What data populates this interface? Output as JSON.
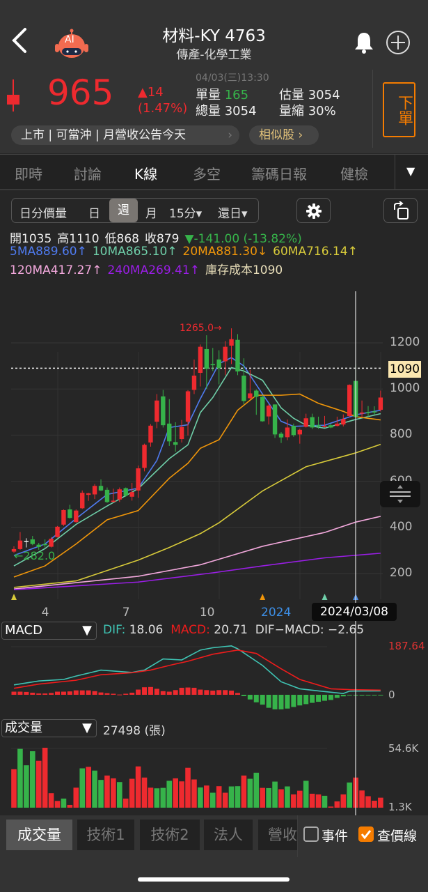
{
  "header": {
    "title": "材料-KY 4763",
    "subtitle": "傳產-化學工業",
    "ai_label": "AI"
  },
  "quote": {
    "price": "965",
    "change": "▲14",
    "change_pct": "(1.47%)",
    "datetime": "04/03(三)13:30",
    "single_vol_label": "單量",
    "single_vol": "165",
    "total_vol_label": "總量",
    "total_vol": "3054",
    "est_vol_label": "估量",
    "est_vol": "3054",
    "vol_ratio_label": "量縮",
    "vol_ratio": "30%",
    "order_button": "下單",
    "tags": "上市 | 可當沖 | 月營收公告今天",
    "similar": "相似股"
  },
  "tabs": [
    {
      "label": "即時"
    },
    {
      "label": "討論"
    },
    {
      "label": "K線"
    },
    {
      "label": "多空"
    },
    {
      "label": "籌碼日報"
    },
    {
      "label": "健檢"
    }
  ],
  "periods": [
    {
      "label": "日分價量"
    },
    {
      "label": "日"
    },
    {
      "label": "週"
    },
    {
      "label": "月"
    },
    {
      "label": "15分▾"
    },
    {
      "label": "還日▾"
    }
  ],
  "ohlc": {
    "open": "開1035",
    "high": "高1110",
    "low": "低868",
    "close": "收879",
    "change": "▼-141.00 (-13.82%)"
  },
  "ma_labels": [
    {
      "text": "5MA889.60↑",
      "color": "#4f7bf0"
    },
    {
      "text": "10MA865.10↑",
      "color": "#6fcfa9"
    },
    {
      "text": "20MA881.30↓",
      "color": "#f0960a"
    },
    {
      "text": "60MA716.14↑",
      "color": "#d8cb3a"
    },
    {
      "text": "120MA417.27↑",
      "color": "#f2a8dc"
    },
    {
      "text": "240MA269.41↑",
      "color": "#9a1ee6"
    }
  ],
  "cost_label": "庫存成本1090",
  "colors": {
    "up": "#ee2a2f",
    "down": "#36b34a",
    "accent": "#f57c00"
  },
  "chart_data": {
    "type": "candlestick",
    "price_ticks": [
      1200,
      1000,
      800,
      600,
      400,
      200
    ],
    "x_labels": [
      {
        "text": "4",
        "i": 5
      },
      {
        "text": "7",
        "i": 18
      },
      {
        "text": "10",
        "i": 31
      },
      {
        "text": "2024",
        "i": 42
      }
    ],
    "crosshair_date": "2024/03/08",
    "crosshair_index": 55,
    "cost_line": 1090,
    "cost_line_label": "1090",
    "high_annotation": "1265.0→",
    "low_annotation": "←282.0",
    "candles": [
      [
        295,
        318,
        290,
        306
      ],
      [
        306,
        380,
        303,
        343
      ],
      [
        341,
        353,
        313,
        341
      ],
      [
        348,
        363,
        323,
        328
      ],
      [
        325,
        333,
        303,
        315
      ],
      [
        328,
        348,
        313,
        323
      ],
      [
        316,
        358,
        313,
        351
      ],
      [
        358,
        406,
        356,
        403
      ],
      [
        412,
        478,
        406,
        475
      ],
      [
        478,
        498,
        438,
        441
      ],
      [
        423,
        478,
        420,
        473
      ],
      [
        483,
        560,
        480,
        550
      ],
      [
        541,
        550,
        515,
        548
      ],
      [
        543,
        588,
        523,
        580
      ],
      [
        580,
        608,
        558,
        560
      ],
      [
        563,
        573,
        506,
        510
      ],
      [
        511,
        568,
        508,
        516
      ],
      [
        521,
        573,
        510,
        565
      ],
      [
        570,
        573,
        533,
        538
      ],
      [
        533,
        593,
        516,
        553
      ],
      [
        560,
        668,
        528,
        656
      ],
      [
        658,
        763,
        643,
        758
      ],
      [
        768,
        848,
        750,
        841
      ],
      [
        858,
        978,
        830,
        950
      ],
      [
        968,
        996,
        833,
        843
      ],
      [
        850,
        956,
        753,
        773
      ],
      [
        770,
        856,
        728,
        758
      ],
      [
        783,
        866,
        768,
        835
      ],
      [
        858,
        995,
        798,
        990
      ],
      [
        996,
        1128,
        978,
        1058
      ],
      [
        1070,
        1193,
        1011,
        1183
      ],
      [
        1173,
        1233,
        1000,
        1088
      ],
      [
        1108,
        1178,
        1078,
        1103
      ],
      [
        1128,
        1168,
        1020,
        1090
      ],
      [
        1120,
        1208,
        1060,
        1183
      ],
      [
        1188,
        1263,
        1108,
        1216
      ],
      [
        1213,
        1238,
        1060,
        1076
      ],
      [
        1058,
        1133,
        933,
        948
      ],
      [
        960,
        1083,
        953,
        981
      ],
      [
        993,
        998,
        888,
        966
      ],
      [
        966,
        973,
        858,
        860
      ],
      [
        881,
        933,
        846,
        928
      ],
      [
        933,
        933,
        788,
        803
      ],
      [
        806,
        813,
        766,
        790
      ],
      [
        791,
        868,
        778,
        833
      ],
      [
        840,
        850,
        793,
        800
      ],
      [
        803,
        828,
        763,
        823
      ],
      [
        836,
        893,
        833,
        873
      ],
      [
        878,
        893,
        826,
        833
      ],
      [
        843,
        880,
        828,
        838
      ],
      [
        836,
        883,
        833,
        840
      ],
      [
        843,
        850,
        830,
        833
      ],
      [
        840,
        880,
        838,
        850
      ],
      [
        846,
        890,
        838,
        870
      ],
      [
        883,
        1020,
        878,
        1018
      ],
      [
        1035,
        1110,
        868,
        879
      ],
      [
        893,
        950,
        878,
        898
      ],
      [
        900,
        926,
        880,
        896
      ],
      [
        903,
        925,
        888,
        898
      ],
      [
        910,
        993,
        903,
        963
      ]
    ],
    "ma": {
      "5MA": [
        [
          0,
          278
        ],
        [
          5,
          328
        ],
        [
          10,
          438
        ],
        [
          15,
          543
        ],
        [
          20,
          570
        ],
        [
          23,
          690
        ],
        [
          25,
          833
        ],
        [
          28,
          845
        ],
        [
          30,
          958
        ],
        [
          33,
          1110
        ],
        [
          35,
          1136
        ],
        [
          37,
          1100
        ],
        [
          40,
          978
        ],
        [
          43,
          860
        ],
        [
          45,
          838
        ],
        [
          50,
          843
        ],
        [
          55,
          888
        ],
        [
          59,
          908
        ]
      ],
      "10MA": [
        [
          0,
          233
        ],
        [
          5,
          308
        ],
        [
          10,
          413
        ],
        [
          15,
          493
        ],
        [
          20,
          568
        ],
        [
          25,
          698
        ],
        [
          28,
          758
        ],
        [
          30,
          898
        ],
        [
          32,
          963
        ],
        [
          35,
          1093
        ],
        [
          37,
          1078
        ],
        [
          40,
          1038
        ],
        [
          43,
          918
        ],
        [
          45,
          873
        ],
        [
          47,
          843
        ],
        [
          50,
          830
        ],
        [
          55,
          868
        ],
        [
          59,
          893
        ]
      ],
      "20MA": [
        [
          0,
          185
        ],
        [
          5,
          233
        ],
        [
          10,
          328
        ],
        [
          15,
          433
        ],
        [
          20,
          473
        ],
        [
          25,
          613
        ],
        [
          28,
          678
        ],
        [
          30,
          743
        ],
        [
          33,
          780
        ],
        [
          36,
          908
        ],
        [
          39,
          973
        ],
        [
          43,
          973
        ],
        [
          46,
          978
        ],
        [
          49,
          938
        ],
        [
          53,
          903
        ],
        [
          55,
          880
        ],
        [
          59,
          866
        ]
      ],
      "60MA": [
        [
          0,
          140
        ],
        [
          10,
          168
        ],
        [
          20,
          258
        ],
        [
          25,
          313
        ],
        [
          30,
          373
        ],
        [
          33,
          420
        ],
        [
          40,
          558
        ],
        [
          47,
          663
        ],
        [
          55,
          723
        ],
        [
          59,
          760
        ]
      ],
      "120MA": [
        [
          0,
          133
        ],
        [
          20,
          188
        ],
        [
          30,
          238
        ],
        [
          33,
          262
        ],
        [
          40,
          318
        ],
        [
          50,
          378
        ],
        [
          55,
          423
        ],
        [
          59,
          448
        ]
      ],
      "240MA": [
        [
          0,
          130
        ],
        [
          20,
          163
        ],
        [
          32,
          203
        ],
        [
          40,
          233
        ],
        [
          50,
          268
        ],
        [
          59,
          288
        ]
      ]
    },
    "markers": [
      {
        "i": 0,
        "color": "#d8cb3a"
      },
      {
        "i": 40,
        "color": "#f0960a"
      },
      {
        "i": 50,
        "color": "#6fcfa9"
      },
      {
        "i": 55,
        "color": "#4f8fe6"
      }
    ],
    "macd": {
      "name": "MACD",
      "dif_label": "DIF:",
      "dif": "18.06",
      "macd_label": "MACD:",
      "macd": "20.71",
      "diff_label": "DIF−MACD:",
      "diff": "−2.65",
      "ymax_label": "187.64",
      "zero_label": "0",
      "ymax": 187.64,
      "dif_series": [
        [
          0,
          38
        ],
        [
          4,
          53
        ],
        [
          8,
          59
        ],
        [
          10,
          72
        ],
        [
          14,
          95
        ],
        [
          19,
          86
        ],
        [
          21,
          95
        ],
        [
          24,
          138
        ],
        [
          27,
          134
        ],
        [
          30,
          172
        ],
        [
          32,
          181
        ],
        [
          35,
          188
        ],
        [
          36,
          177
        ],
        [
          40,
          113
        ],
        [
          43,
          50
        ],
        [
          46,
          23
        ],
        [
          49,
          15
        ],
        [
          53,
          5
        ],
        [
          54,
          14
        ],
        [
          59,
          15
        ]
      ],
      "macd_series": [
        [
          0,
          25
        ],
        [
          4,
          41
        ],
        [
          10,
          56
        ],
        [
          14,
          77
        ],
        [
          19,
          85
        ],
        [
          22,
          95
        ],
        [
          25,
          113
        ],
        [
          28,
          129
        ],
        [
          32,
          156
        ],
        [
          36,
          172
        ],
        [
          39,
          159
        ],
        [
          43,
          100
        ],
        [
          46,
          59
        ],
        [
          51,
          23
        ],
        [
          54,
          20
        ],
        [
          59,
          18
        ]
      ],
      "hist": [
        12,
        12,
        11,
        8,
        5,
        5,
        7,
        12,
        12,
        13,
        17,
        17,
        17,
        14,
        9,
        6,
        4,
        1,
        4,
        8,
        20,
        29,
        30,
        23,
        14,
        12,
        18,
        27,
        28,
        27,
        20,
        18,
        16,
        18,
        18,
        16,
        7,
        -5,
        -18,
        -29,
        -38,
        -50,
        -56,
        -56,
        -53,
        -47,
        -41,
        -36,
        -31,
        -27,
        -23,
        -20,
        -12,
        -6,
        -2,
        -3,
        -3,
        -2,
        -2,
        -2
      ]
    },
    "volume": {
      "name": "成交量",
      "value_text": "27498 (張)",
      "max_label": "54.6K",
      "min_label": "1.3K",
      "ymin": 1.3,
      "ymax": 54.6,
      "values": [
        35.5,
        53.6,
        39.0,
        51.5,
        43.0,
        54.6,
        14.2,
        7.3,
        9.4,
        3.8,
        19.1,
        36.3,
        37.6,
        34.3,
        26.0,
        29.9,
        27.4,
        24.1,
        9.4,
        27.0,
        38.0,
        28.1,
        19.1,
        18.5,
        18.9,
        25.2,
        27.4,
        24.7,
        36.8,
        26.4,
        19.3,
        21.0,
        14.6,
        20.4,
        14.6,
        20.2,
        20.4,
        29.9,
        27.0,
        32.4,
        18.9,
        18.7,
        24.5,
        17.7,
        20.2,
        13.1,
        16.4,
        25.2,
        13.7,
        13.1,
        11.9,
        2.3,
        6.9,
        13.1,
        23.7,
        28.1,
        16.6,
        11.5,
        7.5,
        10.2
      ],
      "down": [
        2,
        3,
        4,
        9,
        12,
        14,
        15,
        18,
        24,
        25,
        26,
        31,
        33,
        36,
        37,
        39,
        40,
        42,
        43,
        45,
        48,
        51,
        55
      ]
    }
  },
  "bottom_tabs": [
    {
      "label": "成交量"
    },
    {
      "label": "技術1"
    },
    {
      "label": "技術2"
    },
    {
      "label": "法人"
    },
    {
      "label": "營收"
    }
  ],
  "toggles": {
    "event": "事件",
    "price_line": "查價線"
  }
}
